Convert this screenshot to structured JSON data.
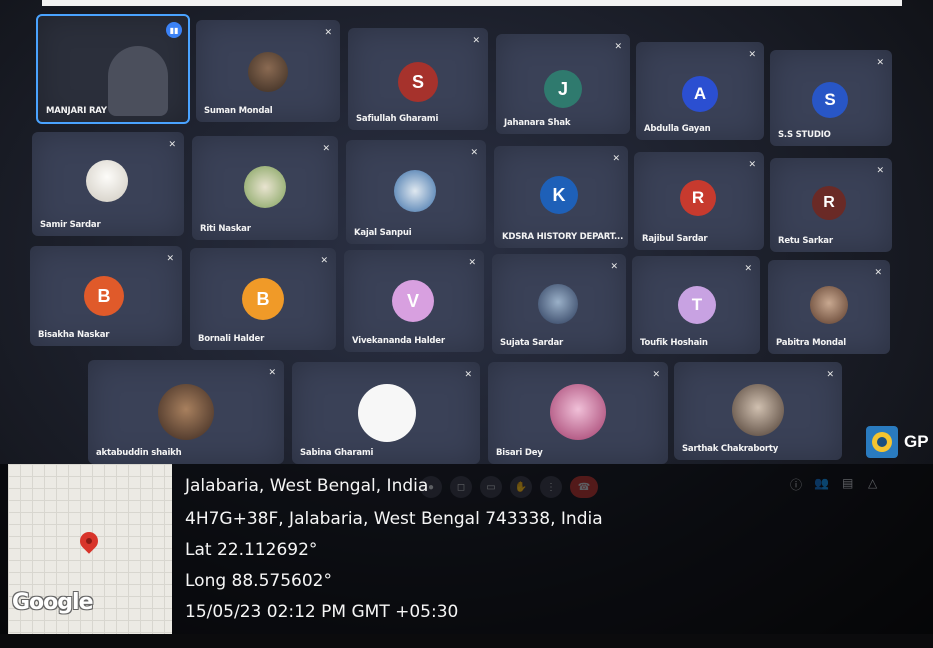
{
  "participants": [
    {
      "name": "MANJARI RAY",
      "initial": "",
      "color": "",
      "kind": "video"
    },
    {
      "name": "Suman Mondal",
      "initial": "",
      "color": "#5a4a3a",
      "kind": "photo"
    },
    {
      "name": "Safiullah Gharami",
      "initial": "S",
      "color": "#a6322c",
      "kind": "letter"
    },
    {
      "name": "Jahanara Shak",
      "initial": "J",
      "color": "#2f7a6e",
      "kind": "letter"
    },
    {
      "name": "Abdulla Gayan",
      "initial": "A",
      "color": "#2b4fd1",
      "kind": "letter"
    },
    {
      "name": "S.S STUDIO",
      "initial": "S",
      "color": "#2856c6",
      "kind": "letter"
    },
    {
      "name": "Samir Sardar",
      "initial": "",
      "color": "#e9e6e0",
      "kind": "photo"
    },
    {
      "name": "Riti Naskar",
      "initial": "",
      "color": "#d7d3c6",
      "kind": "photo"
    },
    {
      "name": "Kajal Sanpui",
      "initial": "",
      "color": "#c9d7e4",
      "kind": "photo"
    },
    {
      "name": "KDSRA HISTORY DEPART...",
      "initial": "K",
      "color": "#1e60b8",
      "kind": "letter"
    },
    {
      "name": "Rajibul Sardar",
      "initial": "R",
      "color": "#c73a2e",
      "kind": "letter"
    },
    {
      "name": "Retu Sarkar",
      "initial": "R",
      "color": "#6a2a26",
      "kind": "letter"
    },
    {
      "name": "Bisakha Naskar",
      "initial": "B",
      "color": "#e05a2a",
      "kind": "letter"
    },
    {
      "name": "Bornali Halder",
      "initial": "B",
      "color": "#f09a28",
      "kind": "letter"
    },
    {
      "name": "Vivekananda Halder",
      "initial": "V",
      "color": "#d8a0e0",
      "kind": "letter"
    },
    {
      "name": "Sujata Sardar",
      "initial": "",
      "color": "#3a5a80",
      "kind": "photo"
    },
    {
      "name": "Toufik Hoshain",
      "initial": "T",
      "color": "#c8a2e2",
      "kind": "letter"
    },
    {
      "name": "Pabitra Mondal",
      "initial": "",
      "color": "#8a6a5a",
      "kind": "photo"
    },
    {
      "name": "aktabuddin shaikh",
      "initial": "",
      "color": "#6a4a3a",
      "kind": "photo"
    },
    {
      "name": "Sabina Gharami",
      "initial": "",
      "color": "#f4f4f4",
      "kind": "photo"
    },
    {
      "name": "Bisari Dey",
      "initial": "",
      "color": "#c87aa0",
      "kind": "photo"
    },
    {
      "name": "Sarthak Chakraborty",
      "initial": "",
      "color": "#5a5a60",
      "kind": "photo"
    }
  ],
  "gps_app_label": "GP",
  "location": {
    "line1": "Jalabaria, West Bengal, India",
    "line2": "4H7G+38F, Jalabaria, West Bengal 743338, India",
    "lat": "Lat 22.112692°",
    "long": "Long 88.575602°",
    "datetime": "15/05/23 02:12 PM GMT +05:30"
  },
  "map_brand": "Google",
  "icons": [
    "mic-off-icon",
    "speaking-icon",
    "map-pin-icon",
    "camera-icon",
    "end-call-icon",
    "info-icon",
    "people-icon",
    "chat-icon",
    "activities-icon"
  ]
}
